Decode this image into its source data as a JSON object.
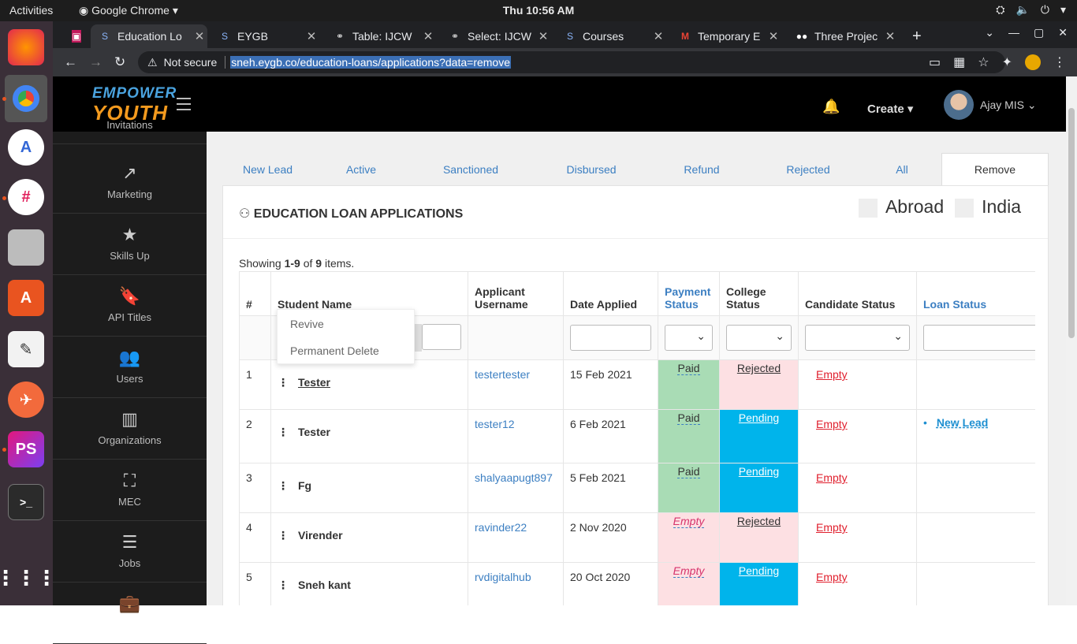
{
  "os": {
    "activities": "Activities",
    "app": "Google Chrome",
    "clock": "Thu 10:56 AM"
  },
  "browser": {
    "tabs": [
      {
        "label": "Education Lo",
        "icon": "eygb-icon"
      },
      {
        "label": "EYGB",
        "icon": "eygb-icon"
      },
      {
        "label": "Table: IJCW",
        "icon": "link-icon"
      },
      {
        "label": "Select: IJCW",
        "icon": "link-icon"
      },
      {
        "label": "Courses",
        "icon": "eygb-icon"
      },
      {
        "label": "Temporary E",
        "icon": "gmail-icon"
      },
      {
        "label": "Three Projec",
        "icon": "medium-icon"
      }
    ],
    "security": "Not secure",
    "url": "sneh.eygb.co/education-loans/applications?data=remove"
  },
  "header": {
    "logo_top": "EMPOWER",
    "logo_bottom": "YOUTH",
    "create": "Create",
    "user": "Ajay MIS"
  },
  "sidebar": {
    "partial": "Invitations",
    "items": [
      {
        "label": "Marketing",
        "icon": "share-icon"
      },
      {
        "label": "Skills Up",
        "icon": "star-icon"
      },
      {
        "label": "API Titles",
        "icon": "bookmark-icon"
      },
      {
        "label": "Users",
        "icon": "users-icon"
      },
      {
        "label": "Organizations",
        "icon": "building-icon"
      },
      {
        "label": "MEC",
        "icon": "mec-icon"
      },
      {
        "label": "Jobs",
        "icon": "jobs-icon"
      }
    ]
  },
  "status_tabs": [
    "New Lead",
    "Active",
    "Sanctioned",
    "Disbursed",
    "Refund",
    "Rejected",
    "All",
    "Remove"
  ],
  "card": {
    "title": "EDUCATION LOAN APPLICATIONS",
    "region_a": "Abroad",
    "region_b": "India"
  },
  "summary": {
    "prefix": "Showing ",
    "range": "1-9",
    "mid": " of ",
    "total": "9",
    "suffix": " items."
  },
  "table": {
    "headers": [
      "#",
      "Student Name",
      "Applicant Username",
      "Date Applied",
      "Payment Status",
      "College Status",
      "Candidate Status",
      "Loan Status"
    ],
    "rows": [
      {
        "n": "1",
        "name": "Tester",
        "user": "testertester",
        "date": "15 Feb 2021",
        "payment": "Paid",
        "college": "Rejected",
        "candidate": "Empty",
        "loan": ""
      },
      {
        "n": "2",
        "name": "Tester",
        "user": "tester12",
        "date": "6 Feb 2021",
        "payment": "Paid",
        "college": "Pending",
        "candidate": "Empty",
        "loan": "New Lead"
      },
      {
        "n": "3",
        "name": "Fg",
        "user": "shalyaapugt897",
        "date": "5 Feb 2021",
        "payment": "Paid",
        "college": "Pending",
        "candidate": "Empty",
        "loan": ""
      },
      {
        "n": "4",
        "name": "Virender",
        "user": "ravinder22",
        "date": "2 Nov 2020",
        "payment": "Empty",
        "college": "Rejected",
        "candidate": "Empty",
        "loan": ""
      },
      {
        "n": "5",
        "name": "Sneh kant",
        "user": "rvdigitalhub",
        "date": "20 Oct 2020",
        "payment": "Empty",
        "college": "Pending",
        "candidate": "Empty",
        "loan": ""
      }
    ]
  },
  "popup": {
    "revive": "Revive",
    "delete": "Permanent Delete"
  }
}
